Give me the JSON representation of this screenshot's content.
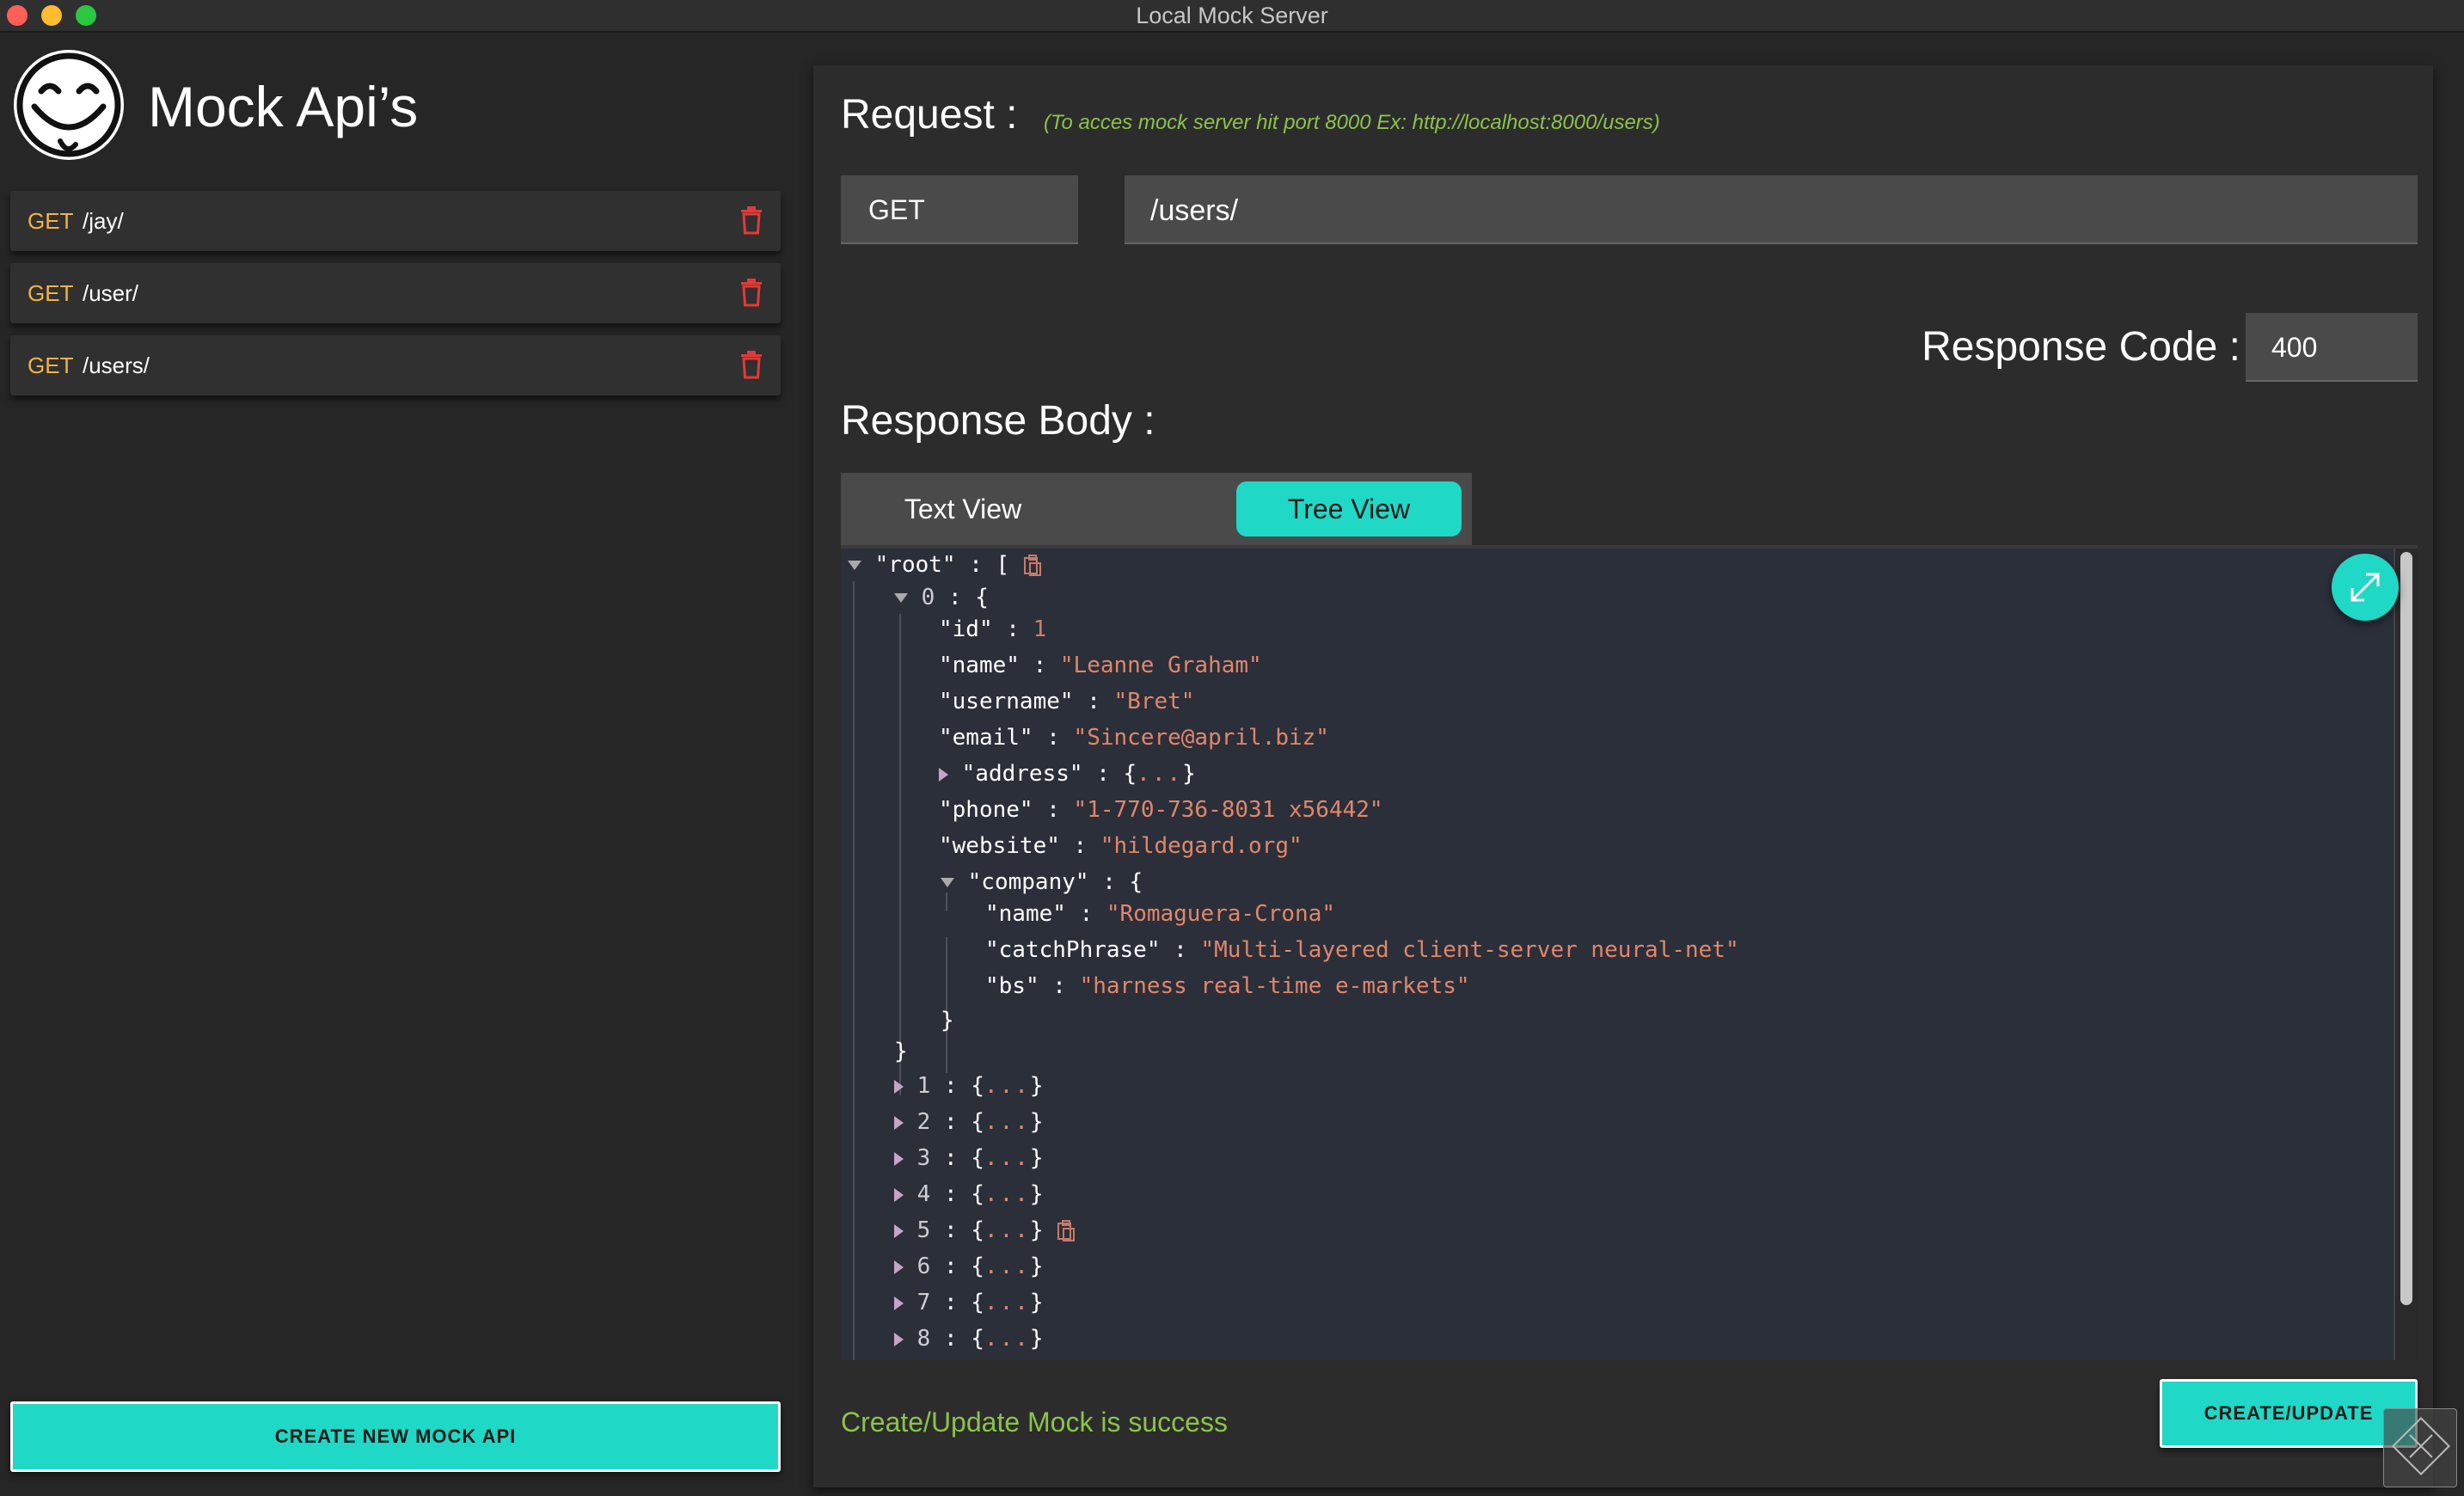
{
  "window": {
    "title": "Local Mock Server"
  },
  "sidebar": {
    "app_title": "Mock Api’s",
    "apis": [
      {
        "method": "GET",
        "path": "/jay/"
      },
      {
        "method": "GET",
        "path": "/user/"
      },
      {
        "method": "GET",
        "path": "/users/"
      }
    ],
    "create_button": "CREATE NEW MOCK API"
  },
  "request": {
    "label": "Request :",
    "hint": "(To acces mock server hit port 8000 Ex: http://localhost:8000/users)",
    "method": "GET",
    "url": "/users/"
  },
  "response": {
    "code_label": "Response Code :",
    "code": "400",
    "body_label": "Response Body :",
    "tabs": {
      "text": "Text View",
      "tree": "Tree View",
      "active": "tree"
    }
  },
  "tree": {
    "root_key": "\"root\"",
    "item0_index": "0",
    "fields": {
      "id_key": "\"id\"",
      "id_val": "1",
      "name_key": "\"name\"",
      "name_val": "\"Leanne Graham\"",
      "username_key": "\"username\"",
      "username_val": "\"Bret\"",
      "email_key": "\"email\"",
      "email_val": "\"Sincere@april.biz\"",
      "address_key": "\"address\"",
      "phone_key": "\"phone\"",
      "phone_val": "\"1-770-736-8031 x56442\"",
      "website_key": "\"website\"",
      "website_val": "\"hildegard.org\"",
      "company_key": "\"company\"",
      "cname_key": "\"name\"",
      "cname_val": "\"Romaguera-Crona\"",
      "catch_key": "\"catchPhrase\"",
      "catch_val": "\"Multi-layered client-server neural-net\"",
      "bs_key": "\"bs\"",
      "bs_val": "\"harness real-time e-markets\""
    },
    "collapsed_items": [
      "1",
      "2",
      "3",
      "4",
      "5",
      "6",
      "7",
      "8"
    ]
  },
  "footer": {
    "status": "Create/Update Mock is success",
    "submit_button": "CREATE/UPDATE"
  },
  "colors": {
    "accent": "#1fd8c5",
    "method": "#f0b34a",
    "success": "#8bc34a",
    "json_string": "#e0876a",
    "delete": "#e53935"
  }
}
